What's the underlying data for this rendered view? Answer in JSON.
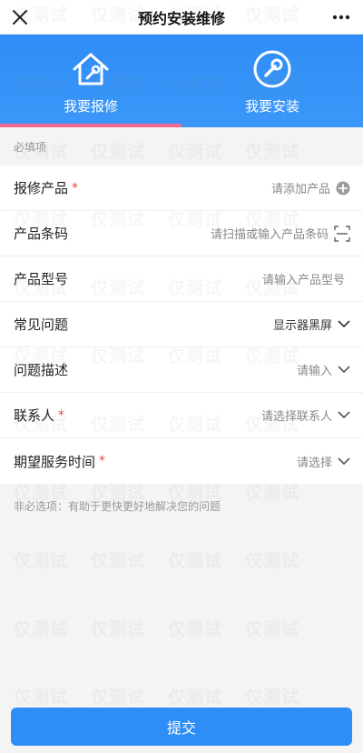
{
  "header": {
    "title": "预约安装维修"
  },
  "tabs": [
    {
      "label": "我要报修",
      "active": true
    },
    {
      "label": "我要安装",
      "active": false
    }
  ],
  "form": {
    "required_title": "必填项",
    "rows": [
      {
        "label": "报修产品",
        "required": true,
        "value": "请添加产品"
      },
      {
        "label": "产品条码",
        "required": false,
        "value": "请扫描或输入产品条码"
      },
      {
        "label": "产品型号",
        "required": false,
        "value": "请输入产品型号"
      },
      {
        "label": "常见问题",
        "required": false,
        "value": "显示器黑屏"
      },
      {
        "label": "问题描述",
        "required": false,
        "value": "请输入"
      },
      {
        "label": "联系人",
        "required": true,
        "value": "请选择联系人"
      },
      {
        "label": "期望服务时间",
        "required": true,
        "value": "请选择"
      }
    ],
    "required_mark": "*"
  },
  "optional_note": "非必选项：有助于更快更好地解决您的问题",
  "submit_label": "提交",
  "watermark_text": "仅测试",
  "colors": {
    "primary": "#2f8df6",
    "indicator": "#f06a92",
    "required": "#e04a4a"
  }
}
